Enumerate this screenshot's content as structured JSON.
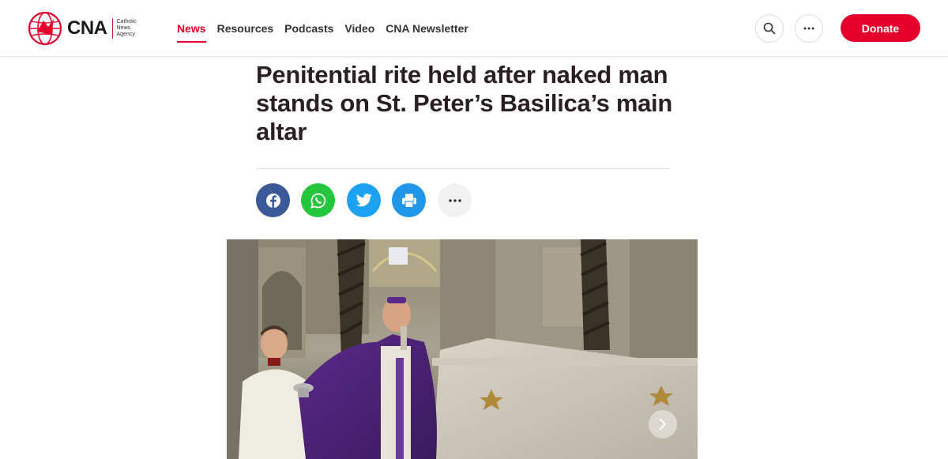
{
  "brand": {
    "name": "CNA",
    "sub_line1": "Catholic",
    "sub_line2": "News",
    "sub_line3": "Agency",
    "accent": "#e4002b"
  },
  "nav": {
    "items": [
      {
        "label": "News",
        "active": true
      },
      {
        "label": "Resources",
        "active": false
      },
      {
        "label": "Podcasts",
        "active": false
      },
      {
        "label": "Video",
        "active": false
      },
      {
        "label": "CNA Newsletter",
        "active": false
      }
    ]
  },
  "header_actions": {
    "search_icon": "search-icon",
    "more_icon": "more-horizontal-icon",
    "donate_label": "Donate"
  },
  "article": {
    "headline": "Penitential rite held after naked man stands on St. Peter’s Basilica’s main altar"
  },
  "share": {
    "buttons": [
      {
        "icon": "facebook-icon",
        "color": "#3b5998"
      },
      {
        "icon": "whatsapp-icon",
        "color": "#25c53d"
      },
      {
        "icon": "twitter-icon",
        "color": "#1da1f2"
      },
      {
        "icon": "print-icon",
        "color": "#2196e8"
      },
      {
        "icon": "more-horizontal-icon",
        "color": "#f2f2f2"
      }
    ]
  },
  "hero": {
    "next_icon": "chevron-right-icon"
  }
}
